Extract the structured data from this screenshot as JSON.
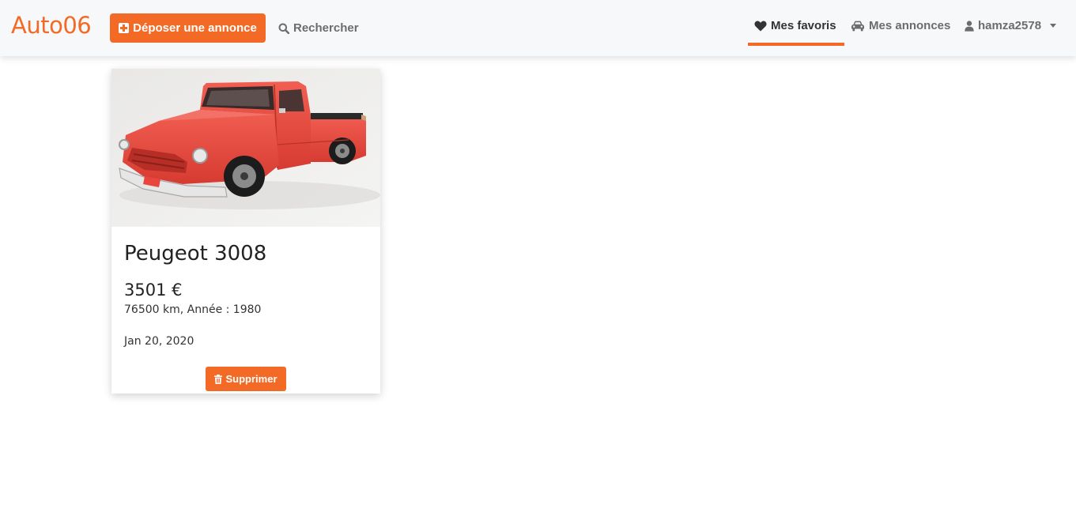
{
  "navbar": {
    "brand": "Auto06",
    "deposit_label": "Déposer une annonce",
    "search_label": "Rechercher",
    "favorites_label": "Mes favoris",
    "listings_label": "Mes annonces",
    "username": "hamza2578"
  },
  "favorites": [
    {
      "title": "Peugeot 3008",
      "price": "3501 €",
      "details": "76500 km, Année : 1980",
      "date": "Jan 20, 2020",
      "delete_label": "Supprimer"
    }
  ],
  "colors": {
    "accent": "#f26a26",
    "navbar_bg": "#f7f8fa",
    "car_body": "#e8463c"
  },
  "icons": {
    "deposit": "plus-square-icon",
    "search": "search-icon",
    "favorites": "heart-icon",
    "listings": "car-icon",
    "user": "user-icon",
    "delete": "trash-icon"
  }
}
